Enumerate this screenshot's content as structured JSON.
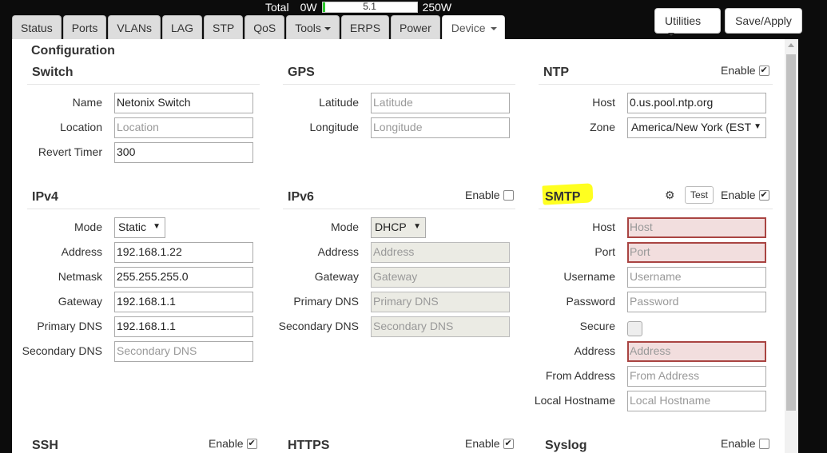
{
  "power": {
    "label": "Total",
    "min": "0W",
    "value": "5.1",
    "max": "250W",
    "fill_fraction": 0.02
  },
  "tabs": [
    {
      "label": "Status"
    },
    {
      "label": "Ports"
    },
    {
      "label": "VLANs"
    },
    {
      "label": "LAG"
    },
    {
      "label": "STP"
    },
    {
      "label": "QoS"
    },
    {
      "label": "Tools"
    },
    {
      "label": "ERPS"
    },
    {
      "label": "Power"
    },
    {
      "label": "Device",
      "active": true
    }
  ],
  "toolbar": {
    "utilities_label": "Utilities",
    "save_label": "Save/Apply"
  },
  "page_title": "Configuration",
  "switch": {
    "title": "Switch",
    "name_label": "Name",
    "name_value": "Netonix Switch",
    "location_label": "Location",
    "location_placeholder": "Location",
    "revert_label": "Revert Timer",
    "revert_value": "300"
  },
  "gps": {
    "title": "GPS",
    "latitude_label": "Latitude",
    "latitude_placeholder": "Latitude",
    "longitude_label": "Longitude",
    "longitude_placeholder": "Longitude"
  },
  "ntp": {
    "title": "NTP",
    "enable_label": "Enable",
    "enabled": true,
    "host_label": "Host",
    "host_value": "0.us.pool.ntp.org",
    "zone_label": "Zone",
    "zone_value": "America/New York (EST"
  },
  "ipv4": {
    "title": "IPv4",
    "mode_label": "Mode",
    "mode_value": "Static",
    "address_label": "Address",
    "address_value": "192.168.1.22",
    "netmask_label": "Netmask",
    "netmask_value": "255.255.255.0",
    "gateway_label": "Gateway",
    "gateway_value": "192.168.1.1",
    "pdns_label": "Primary DNS",
    "pdns_value": "192.168.1.1",
    "sdns_label": "Secondary DNS",
    "sdns_placeholder": "Secondary DNS"
  },
  "ipv6": {
    "title": "IPv6",
    "enable_label": "Enable",
    "enabled": false,
    "mode_label": "Mode",
    "mode_value": "DHCP",
    "address_label": "Address",
    "address_placeholder": "Address",
    "gateway_label": "Gateway",
    "gateway_placeholder": "Gateway",
    "pdns_label": "Primary DNS",
    "pdns_placeholder": "Primary DNS",
    "sdns_label": "Secondary DNS",
    "sdns_placeholder": "Secondary DNS"
  },
  "smtp": {
    "title": "SMTP",
    "test_label": "Test",
    "enable_label": "Enable",
    "enabled": true,
    "highlight_color": "#ffff20",
    "error_color": "#a94442",
    "host_label": "Host",
    "host_placeholder": "Host",
    "port_label": "Port",
    "port_placeholder": "Port",
    "username_label": "Username",
    "username_placeholder": "Username",
    "password_label": "Password",
    "password_placeholder": "Password",
    "secure_label": "Secure",
    "address_label": "Address",
    "address_placeholder": "Address",
    "from_label": "From Address",
    "from_placeholder": "From Address",
    "hostname_label": "Local Hostname",
    "hostname_placeholder": "Local Hostname"
  },
  "ssh": {
    "title": "SSH",
    "enable_label": "Enable",
    "enabled": true
  },
  "https": {
    "title": "HTTPS",
    "enable_label": "Enable",
    "enabled": true
  },
  "syslog": {
    "title": "Syslog",
    "enable_label": "Enable",
    "enabled": false
  },
  "icons": {
    "check": "✔",
    "gear": "⚙",
    "caret": "▾",
    "select_arrow": "▼"
  }
}
